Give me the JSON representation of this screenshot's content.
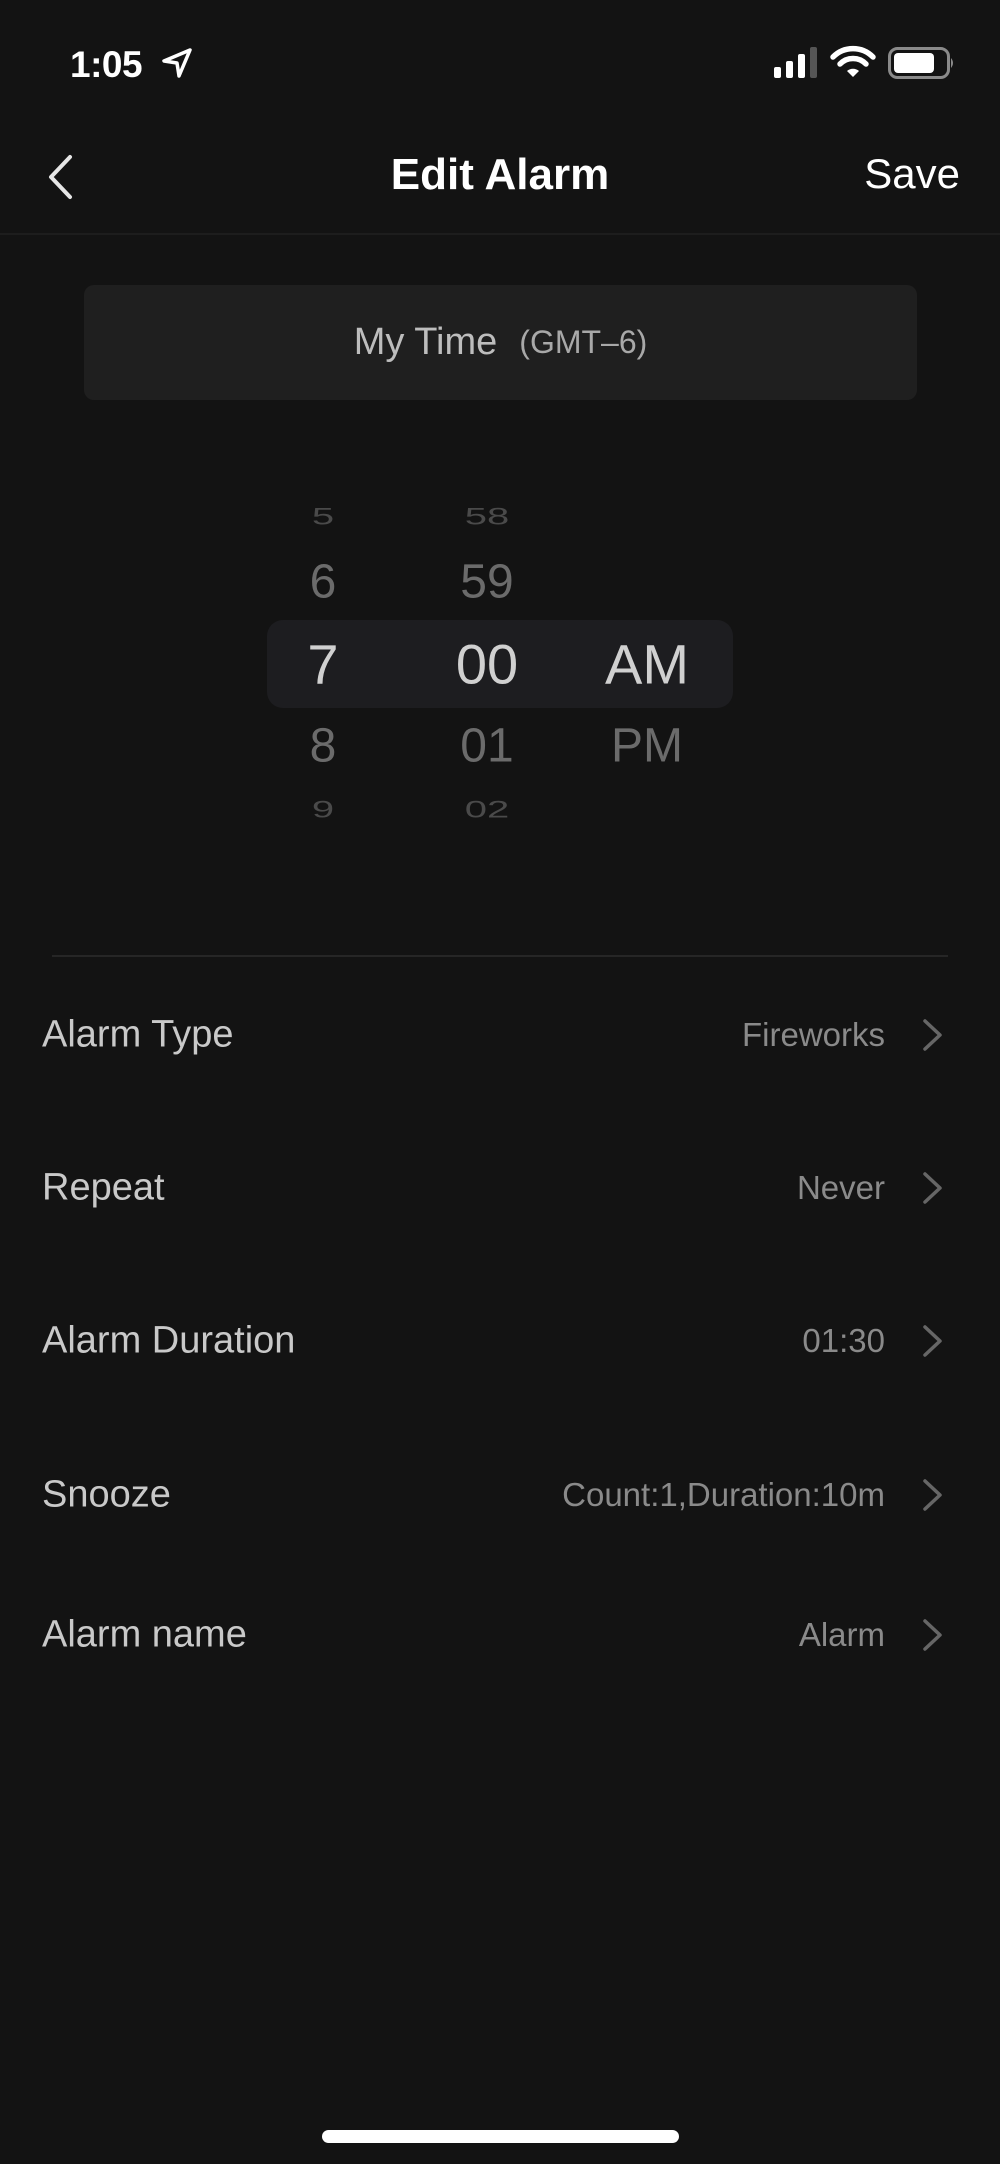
{
  "status_bar": {
    "time": "1:05",
    "location_icon": "location-arrow-icon",
    "signal_icon": "cellular-signal-icon",
    "signal_bars_filled": 3,
    "signal_bars_total": 4,
    "wifi_icon": "wifi-icon",
    "battery_icon": "battery-icon",
    "battery_level": 0.8
  },
  "nav": {
    "back_icon": "chevron-left-icon",
    "title": "Edit Alarm",
    "save_label": "Save"
  },
  "timezone": {
    "label": "My Time",
    "offset": "(GMT–6)"
  },
  "picker": {
    "hours": [
      "5",
      "6",
      "7",
      "8",
      "9"
    ],
    "minutes": [
      "58",
      "59",
      "00",
      "01",
      "02"
    ],
    "periods": [
      "AM",
      "PM"
    ],
    "selected": {
      "hour": "7",
      "minute": "00",
      "period": "AM"
    }
  },
  "settings": [
    {
      "label": "Alarm Type",
      "value": "Fireworks"
    },
    {
      "label": "Repeat",
      "value": "Never"
    },
    {
      "label": "Alarm Duration",
      "value": "01:30"
    },
    {
      "label": "Snooze",
      "value": "Count:1,Duration:10m"
    },
    {
      "label": "Alarm name",
      "value": "Alarm"
    }
  ],
  "colors": {
    "background": "#131313",
    "card": "#1f1f1f",
    "picker_highlight": "#1d1d20",
    "primary_text": "#ffffff",
    "label_text": "#c9c9c9",
    "value_text": "#8a8a8a"
  }
}
